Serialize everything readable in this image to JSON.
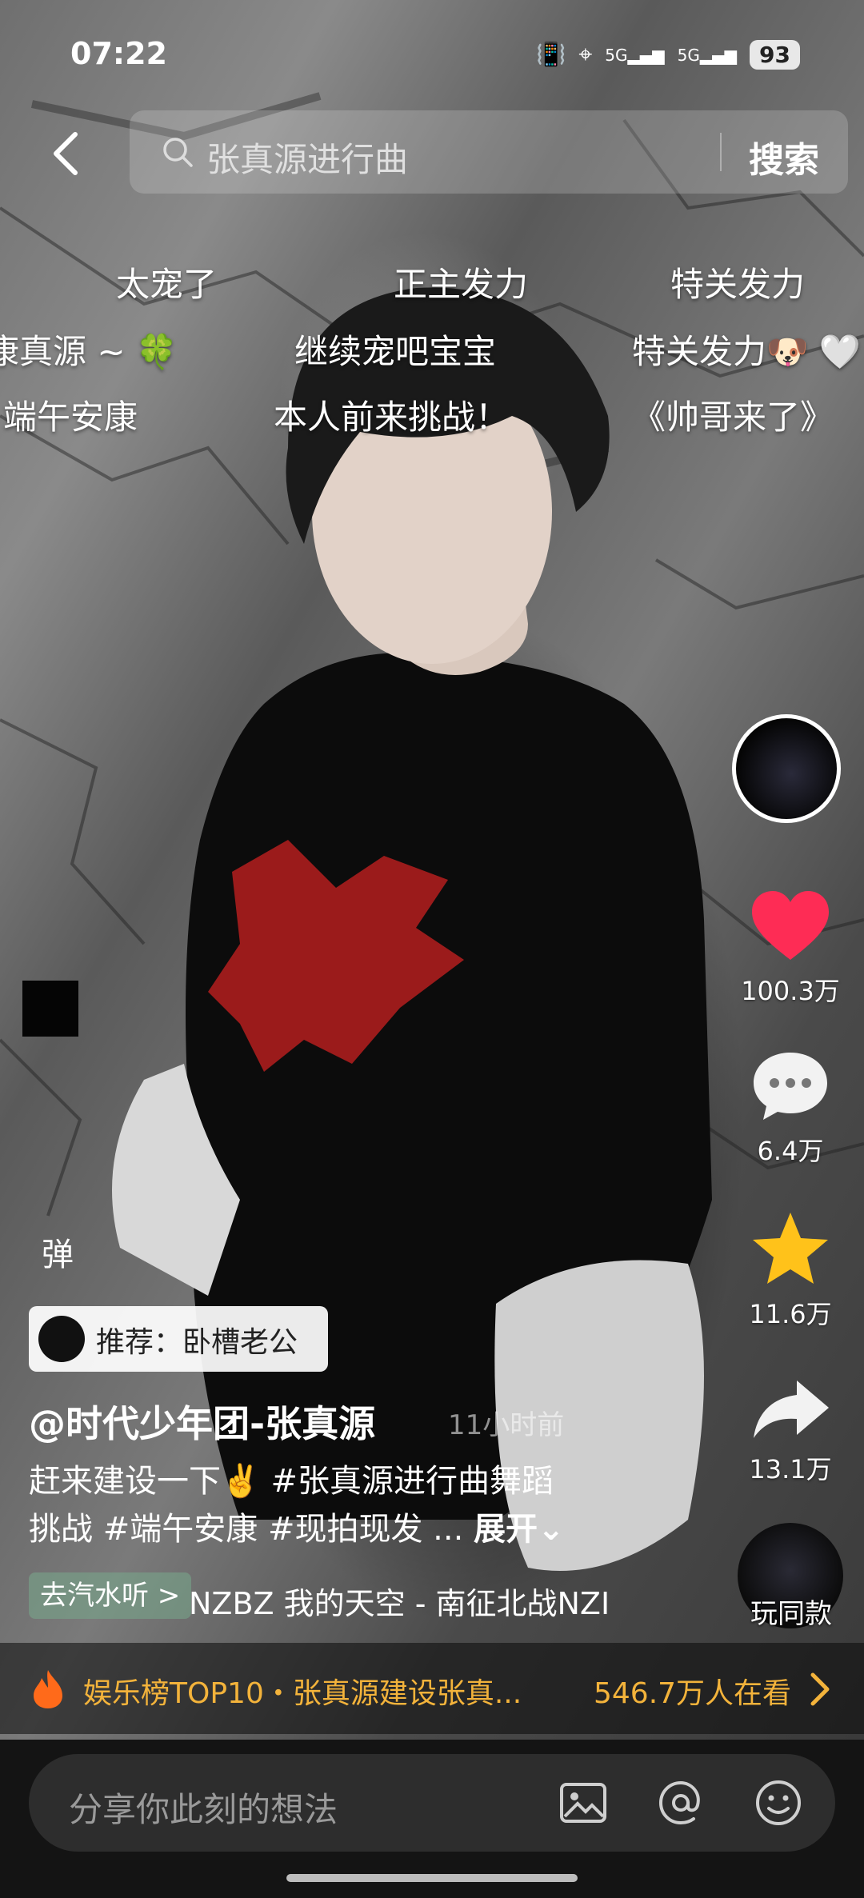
{
  "status_bar": {
    "time": "07:22",
    "network_1": "5G",
    "network_2": "5G",
    "battery": "93"
  },
  "search": {
    "query": "张真源进行曲",
    "button_label": "搜索"
  },
  "danmaku": [
    "太宠了",
    "正主发力",
    "特关发力",
    "康真源 ~ 🍀",
    "继续宠吧宝宝",
    "特关发力🐶 🤍",
    "端午安康",
    "本人前来挑战！",
    "《帅哥来了》"
  ],
  "actions": {
    "likes": "100.3万",
    "comments": "6.4万",
    "favorites": "11.6万",
    "shares": "13.1万"
  },
  "danmaku_toggle": "弹",
  "recommend": {
    "label": "推荐：卧槽老公"
  },
  "post": {
    "author": "@时代少年团-张真源",
    "time": "11小时前",
    "caption_line_1": "赶来建设一下✌️ #张真源进行曲舞蹈",
    "caption_line_2": "挑战 #端午安康 #现拍现发 ...",
    "expand_label": "展开"
  },
  "music": {
    "chip_label": "去汽水听 >",
    "track_text": "NZBZ    我的天空 - 南征北战NZI",
    "same_label": "玩同款"
  },
  "ranking": {
    "label": "娱乐榜TOP10・张真源建设张真...",
    "viewers": "546.7万人在看"
  },
  "comment_bar": {
    "placeholder": "分享你此刻的想法"
  },
  "colors": {
    "accent_gold": "#f3b33b",
    "like_red": "#fe2c55",
    "star_yellow": "#ffc21a"
  }
}
